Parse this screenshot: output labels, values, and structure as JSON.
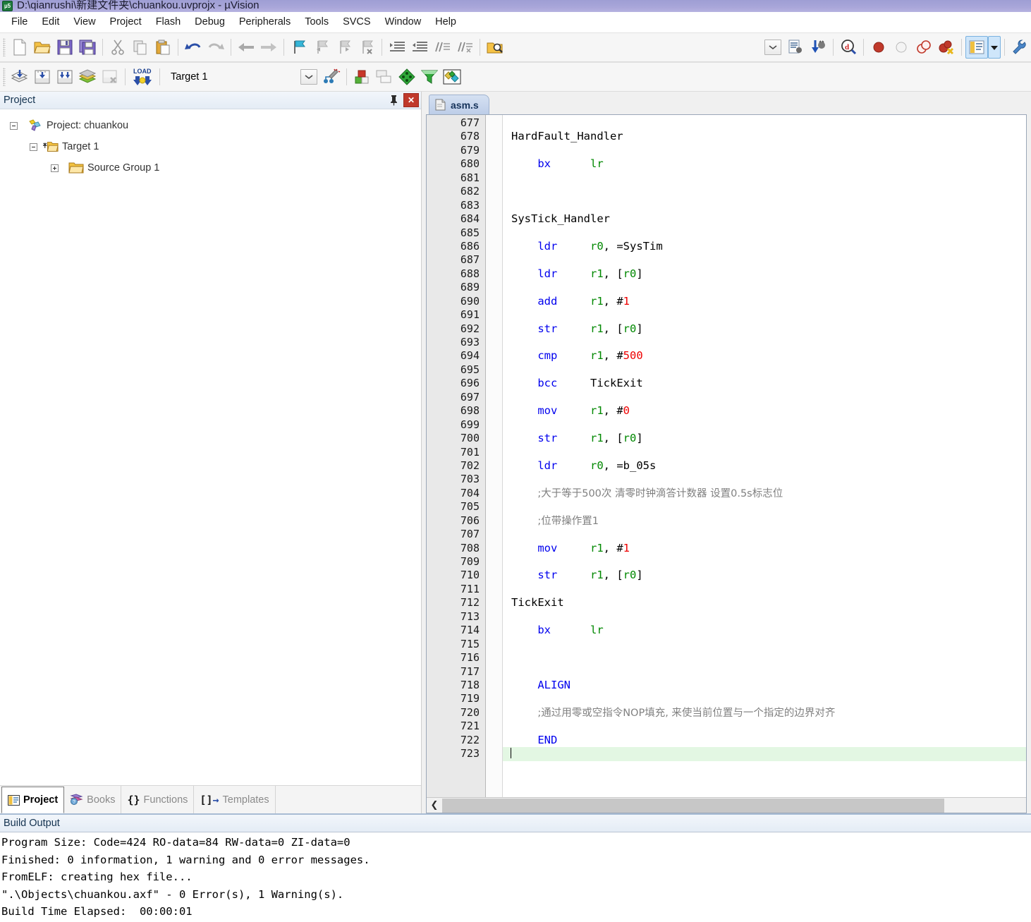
{
  "window": {
    "title": "D:\\qianrushi\\新建文件夹\\chuankou.uvprojx - µVision",
    "app_icon": "uvision-icon"
  },
  "menubar": {
    "items": [
      {
        "label": "File"
      },
      {
        "label": "Edit"
      },
      {
        "label": "View"
      },
      {
        "label": "Project"
      },
      {
        "label": "Flash"
      },
      {
        "label": "Debug"
      },
      {
        "label": "Peripherals"
      },
      {
        "label": "Tools"
      },
      {
        "label": "SVCS"
      },
      {
        "label": "Window"
      },
      {
        "label": "Help"
      }
    ]
  },
  "toolbar_main": {
    "buttons": [
      {
        "name": "new-file-icon"
      },
      {
        "name": "open-file-icon"
      },
      {
        "name": "save-icon"
      },
      {
        "name": "save-all-icon"
      },
      {
        "name": "cut-icon"
      },
      {
        "name": "copy-icon"
      },
      {
        "name": "paste-icon"
      },
      {
        "name": "undo-icon"
      },
      {
        "name": "redo-icon"
      },
      {
        "name": "navigate-back-icon"
      },
      {
        "name": "navigate-forward-icon"
      },
      {
        "name": "bookmark-toggle-icon"
      },
      {
        "name": "bookmark-prev-icon"
      },
      {
        "name": "bookmark-next-icon"
      },
      {
        "name": "bookmark-clear-icon"
      },
      {
        "name": "indent-icon"
      },
      {
        "name": "outdent-icon"
      },
      {
        "name": "comment-icon"
      },
      {
        "name": "uncomment-icon"
      },
      {
        "name": "find-in-files-icon"
      },
      {
        "name": "configure-dropdown-icon"
      },
      {
        "name": "debug-settings-icon"
      },
      {
        "name": "start-debug-icon"
      },
      {
        "name": "find-icon"
      },
      {
        "name": "insert-breakpoint-icon"
      },
      {
        "name": "disable-breakpoint-icon"
      },
      {
        "name": "disable-all-breakpoints-icon"
      },
      {
        "name": "kill-all-breakpoints-icon"
      },
      {
        "name": "project-window-icon"
      },
      {
        "name": "project-window-dropdown-icon"
      },
      {
        "name": "configure-target-icon"
      }
    ]
  },
  "toolbar_build": {
    "buttons": [
      {
        "name": "translate-file-icon"
      },
      {
        "name": "build-target-icon"
      },
      {
        "name": "rebuild-all-icon"
      },
      {
        "name": "batch-build-icon"
      },
      {
        "name": "stop-build-icon"
      },
      {
        "name": "download-icon"
      },
      {
        "name": "manage-wizard-icon"
      },
      {
        "name": "manage-components-icon"
      },
      {
        "name": "multi-project-icon"
      },
      {
        "name": "pack-installer-icon"
      },
      {
        "name": "pack-filter-icon"
      },
      {
        "name": "pack-manage-icon"
      }
    ],
    "target_selected": "Target 1"
  },
  "project_panel": {
    "title": "Project",
    "pin_icon": "pin-icon",
    "close_icon": "close-icon",
    "tree": [
      {
        "label": "Project: chuankou",
        "icon": "project-icon",
        "expander": "minus",
        "depth": 0
      },
      {
        "label": "Target 1",
        "icon": "target-folder-icon",
        "expander": "minus",
        "depth": 1
      },
      {
        "label": "Source Group 1",
        "icon": "folder-icon",
        "expander": "plus",
        "depth": 2
      }
    ],
    "tabs": [
      {
        "label": "Project",
        "icon": "project-tab-icon",
        "active": true
      },
      {
        "label": "Books",
        "icon": "books-icon",
        "active": false
      },
      {
        "label": "Functions",
        "icon": "functions-icon",
        "active": false
      },
      {
        "label": "Templates",
        "icon": "templates-icon",
        "active": false
      }
    ]
  },
  "editor": {
    "tab": {
      "label": "asm.s",
      "icon": "source-file-icon"
    },
    "first_line_number": 677,
    "current_line": 723,
    "lines": [
      {
        "n": 677,
        "tokens": []
      },
      {
        "n": 678,
        "tokens": [
          {
            "t": "HardFault_Handler",
            "c": "lbl"
          }
        ]
      },
      {
        "n": 679,
        "tokens": []
      },
      {
        "n": 680,
        "tokens": [
          {
            "t": "    ",
            "c": "lbl"
          },
          {
            "t": "bx",
            "c": "mn"
          },
          {
            "t": "      ",
            "c": "lbl"
          },
          {
            "t": "lr",
            "c": "rg"
          }
        ]
      },
      {
        "n": 681,
        "tokens": []
      },
      {
        "n": 682,
        "tokens": []
      },
      {
        "n": 683,
        "tokens": []
      },
      {
        "n": 684,
        "tokens": [
          {
            "t": "SysTick_Handler",
            "c": "lbl"
          }
        ]
      },
      {
        "n": 685,
        "tokens": []
      },
      {
        "n": 686,
        "tokens": [
          {
            "t": "    ",
            "c": "lbl"
          },
          {
            "t": "ldr",
            "c": "mn"
          },
          {
            "t": "     ",
            "c": "lbl"
          },
          {
            "t": "r0",
            "c": "rg"
          },
          {
            "t": ", =SysTim",
            "c": "lbl"
          }
        ]
      },
      {
        "n": 687,
        "tokens": []
      },
      {
        "n": 688,
        "tokens": [
          {
            "t": "    ",
            "c": "lbl"
          },
          {
            "t": "ldr",
            "c": "mn"
          },
          {
            "t": "     ",
            "c": "lbl"
          },
          {
            "t": "r1",
            "c": "rg"
          },
          {
            "t": ", [",
            "c": "lbl"
          },
          {
            "t": "r0",
            "c": "rg"
          },
          {
            "t": "]",
            "c": "lbl"
          }
        ]
      },
      {
        "n": 689,
        "tokens": []
      },
      {
        "n": 690,
        "tokens": [
          {
            "t": "    ",
            "c": "lbl"
          },
          {
            "t": "add",
            "c": "mn"
          },
          {
            "t": "     ",
            "c": "lbl"
          },
          {
            "t": "r1",
            "c": "rg"
          },
          {
            "t": ", #",
            "c": "lbl"
          },
          {
            "t": "1",
            "c": "num"
          }
        ]
      },
      {
        "n": 691,
        "tokens": []
      },
      {
        "n": 692,
        "tokens": [
          {
            "t": "    ",
            "c": "lbl"
          },
          {
            "t": "str",
            "c": "mn"
          },
          {
            "t": "     ",
            "c": "lbl"
          },
          {
            "t": "r1",
            "c": "rg"
          },
          {
            "t": ", [",
            "c": "lbl"
          },
          {
            "t": "r0",
            "c": "rg"
          },
          {
            "t": "]",
            "c": "lbl"
          }
        ]
      },
      {
        "n": 693,
        "tokens": []
      },
      {
        "n": 694,
        "tokens": [
          {
            "t": "    ",
            "c": "lbl"
          },
          {
            "t": "cmp",
            "c": "mn"
          },
          {
            "t": "     ",
            "c": "lbl"
          },
          {
            "t": "r1",
            "c": "rg"
          },
          {
            "t": ", #",
            "c": "lbl"
          },
          {
            "t": "500",
            "c": "num"
          }
        ]
      },
      {
        "n": 695,
        "tokens": []
      },
      {
        "n": 696,
        "tokens": [
          {
            "t": "    ",
            "c": "lbl"
          },
          {
            "t": "bcc",
            "c": "mn"
          },
          {
            "t": "     ",
            "c": "lbl"
          },
          {
            "t": "TickExit",
            "c": "lbl"
          }
        ]
      },
      {
        "n": 697,
        "tokens": []
      },
      {
        "n": 698,
        "tokens": [
          {
            "t": "    ",
            "c": "lbl"
          },
          {
            "t": "mov",
            "c": "mn"
          },
          {
            "t": "     ",
            "c": "lbl"
          },
          {
            "t": "r1",
            "c": "rg"
          },
          {
            "t": ", #",
            "c": "lbl"
          },
          {
            "t": "0",
            "c": "num"
          }
        ]
      },
      {
        "n": 699,
        "tokens": []
      },
      {
        "n": 700,
        "tokens": [
          {
            "t": "    ",
            "c": "lbl"
          },
          {
            "t": "str",
            "c": "mn"
          },
          {
            "t": "     ",
            "c": "lbl"
          },
          {
            "t": "r1",
            "c": "rg"
          },
          {
            "t": ", [",
            "c": "lbl"
          },
          {
            "t": "r0",
            "c": "rg"
          },
          {
            "t": "]",
            "c": "lbl"
          }
        ]
      },
      {
        "n": 701,
        "tokens": []
      },
      {
        "n": 702,
        "tokens": [
          {
            "t": "    ",
            "c": "lbl"
          },
          {
            "t": "ldr",
            "c": "mn"
          },
          {
            "t": "     ",
            "c": "lbl"
          },
          {
            "t": "r0",
            "c": "rg"
          },
          {
            "t": ", =b_05s",
            "c": "lbl"
          }
        ]
      },
      {
        "n": 703,
        "tokens": []
      },
      {
        "n": 704,
        "tokens": [
          {
            "t": "    ",
            "c": "lbl"
          },
          {
            "t": ";大于等于500次 清零时钟滴答计数器 设置0.5s标志位",
            "c": "cm"
          }
        ]
      },
      {
        "n": 705,
        "tokens": []
      },
      {
        "n": 706,
        "tokens": [
          {
            "t": "    ",
            "c": "lbl"
          },
          {
            "t": ";位带操作置1",
            "c": "cm"
          }
        ]
      },
      {
        "n": 707,
        "tokens": []
      },
      {
        "n": 708,
        "tokens": [
          {
            "t": "    ",
            "c": "lbl"
          },
          {
            "t": "mov",
            "c": "mn"
          },
          {
            "t": "     ",
            "c": "lbl"
          },
          {
            "t": "r1",
            "c": "rg"
          },
          {
            "t": ", #",
            "c": "lbl"
          },
          {
            "t": "1",
            "c": "num"
          }
        ]
      },
      {
        "n": 709,
        "tokens": []
      },
      {
        "n": 710,
        "tokens": [
          {
            "t": "    ",
            "c": "lbl"
          },
          {
            "t": "str",
            "c": "mn"
          },
          {
            "t": "     ",
            "c": "lbl"
          },
          {
            "t": "r1",
            "c": "rg"
          },
          {
            "t": ", [",
            "c": "lbl"
          },
          {
            "t": "r0",
            "c": "rg"
          },
          {
            "t": "]",
            "c": "lbl"
          }
        ]
      },
      {
        "n": 711,
        "tokens": []
      },
      {
        "n": 712,
        "tokens": [
          {
            "t": "TickExit",
            "c": "lbl"
          }
        ]
      },
      {
        "n": 713,
        "tokens": []
      },
      {
        "n": 714,
        "tokens": [
          {
            "t": "    ",
            "c": "lbl"
          },
          {
            "t": "bx",
            "c": "mn"
          },
          {
            "t": "      ",
            "c": "lbl"
          },
          {
            "t": "lr",
            "c": "rg"
          }
        ]
      },
      {
        "n": 715,
        "tokens": []
      },
      {
        "n": 716,
        "tokens": []
      },
      {
        "n": 717,
        "tokens": []
      },
      {
        "n": 718,
        "tokens": [
          {
            "t": "    ",
            "c": "lbl"
          },
          {
            "t": "ALIGN",
            "c": "mn"
          }
        ]
      },
      {
        "n": 719,
        "tokens": []
      },
      {
        "n": 720,
        "tokens": [
          {
            "t": "    ",
            "c": "lbl"
          },
          {
            "t": ";通过用零或空指令NOP填充, 来使当前位置与一个指定的边界对齐",
            "c": "cm"
          }
        ]
      },
      {
        "n": 721,
        "tokens": []
      },
      {
        "n": 722,
        "tokens": [
          {
            "t": "    ",
            "c": "lbl"
          },
          {
            "t": "END",
            "c": "mn"
          }
        ]
      },
      {
        "n": 723,
        "tokens": []
      }
    ],
    "scrollbar": {
      "left_arrow": "scroll-left-arrow"
    }
  },
  "build_output": {
    "title": "Build Output",
    "lines": [
      "Program Size: Code=424 RO-data=84 RW-data=0 ZI-data=0",
      "Finished: 0 information, 1 warning and 0 error messages.",
      "FromELF: creating hex file...",
      "\".\\Objects\\chuankou.axf\" - 0 Error(s), 1 Warning(s).",
      "Build Time Elapsed:  00:00:01"
    ]
  },
  "colors": {
    "titlebar": "#a9a6d9",
    "mnemonic": "#0000ee",
    "register": "#008800",
    "literal": "#ee0000",
    "comment": "#808080",
    "current_line": "#e3f7e3",
    "close_button": "#c0392b"
  }
}
